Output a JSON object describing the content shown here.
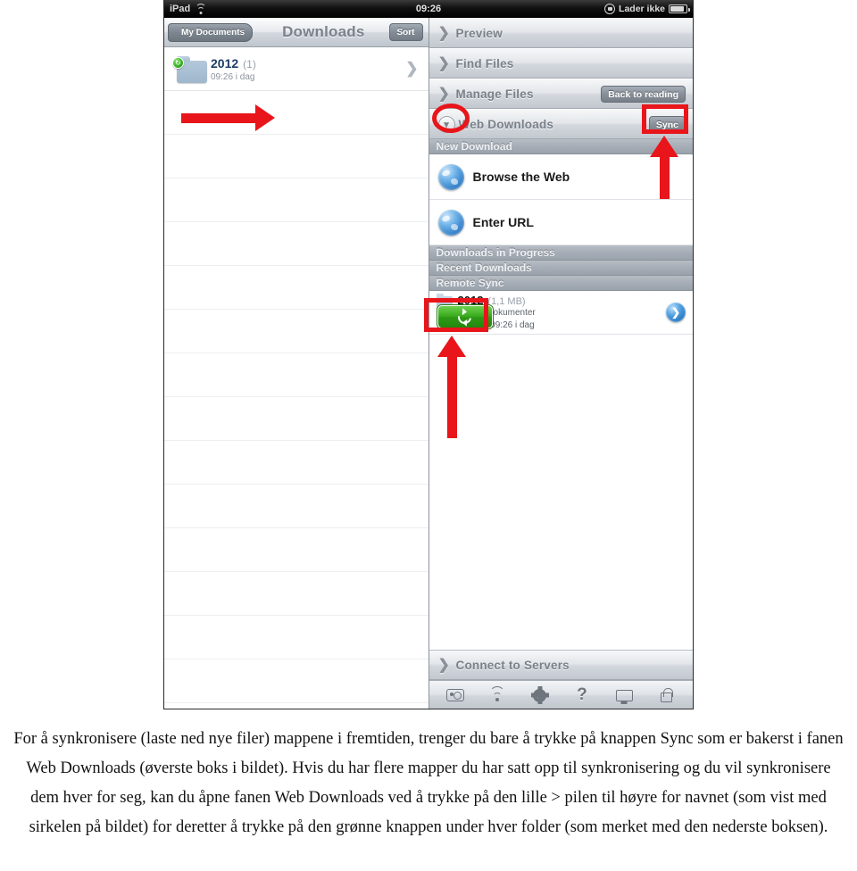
{
  "device": {
    "statusbar": {
      "device_name": "iPad",
      "wifi_icon": "wifi-icon",
      "time": "09:26",
      "rotation_lock_icon": "rotation-lock-icon",
      "battery_text": "Lader ikke",
      "battery_icon": "battery-icon"
    },
    "left_pane": {
      "navbar": {
        "back_button": "My Documents",
        "title": "Downloads",
        "sort_button": "Sort"
      },
      "rows": [
        {
          "name": "2012",
          "count": "(1)",
          "subtitle": "09:26 i dag",
          "badge_icon": "sync-badge-icon",
          "chevron_icon": "chevron-right-icon"
        }
      ],
      "empty_row_count": 14
    },
    "right_pane": {
      "accordion": [
        {
          "label": "Preview",
          "chevron": "❯",
          "chevron_icon": "chevron-right-icon",
          "pill": ""
        },
        {
          "label": "Find Files",
          "chevron": "❯",
          "chevron_icon": "chevron-right-icon",
          "pill": ""
        },
        {
          "label": "Manage Files",
          "chevron": "❯",
          "chevron_icon": "chevron-right-icon",
          "pill": "Back to reading"
        },
        {
          "label": "Web Downloads",
          "chevron": "⌄",
          "chevron_icon": "chevron-down-icon",
          "pill": "Sync"
        }
      ],
      "sections": {
        "new_download": "New Download",
        "downloads_in_progress": "Downloads in Progress",
        "recent_downloads": "Recent Downloads",
        "remote_sync": "Remote Sync"
      },
      "options": [
        {
          "label": "Browse the Web",
          "icon": "globe-icon"
        },
        {
          "label": "Enter URL",
          "icon": "globe-icon"
        }
      ],
      "remote_sync_item": {
        "name": "2012",
        "size": "(1,1 MB)",
        "line1": "P: Saksdokumenter",
        "line2": "st sync: 09:26 i dag",
        "sync_button_icon": "refresh-icon",
        "disclosure_icon": "chevron-right-circle-icon"
      },
      "connect_row": {
        "label": "Connect to Servers",
        "chevron": "❯",
        "chevron_icon": "chevron-right-icon"
      },
      "toolbar_icons": [
        "camera-icon",
        "wifi-icon",
        "gear-icon",
        "help-icon",
        "monitor-icon",
        "lock-icon"
      ],
      "help_glyph": "?"
    }
  },
  "annotations": {
    "circle_web_downloads_chevron": "red-ellipse-highlight",
    "box_sync_button": "red-box-highlight",
    "box_green_sync_button": "red-box-highlight",
    "arrow_to_chevron": "red-arrow-right",
    "arrow_to_sync_button": "red-arrow-up",
    "arrow_to_green_button": "red-arrow-up",
    "color": "#e8151b"
  },
  "caption": {
    "text": "For å synkronisere (laste ned nye filer) mappene i fremtiden, trenger du bare å trykke på knappen Sync som er bakerst i fanen Web Downloads (øverste boks i bildet). Hvis du har flere mapper du har satt opp til synkronisering og du vil synkronisere dem hver for seg, kan du åpne fanen Web Downloads ved å trykke på den lille > pilen til høyre for navnet (som vist med sirkelen på bildet) for deretter å trykke på den grønne knappen under hver folder (som merket med den nederste boksen)."
  }
}
